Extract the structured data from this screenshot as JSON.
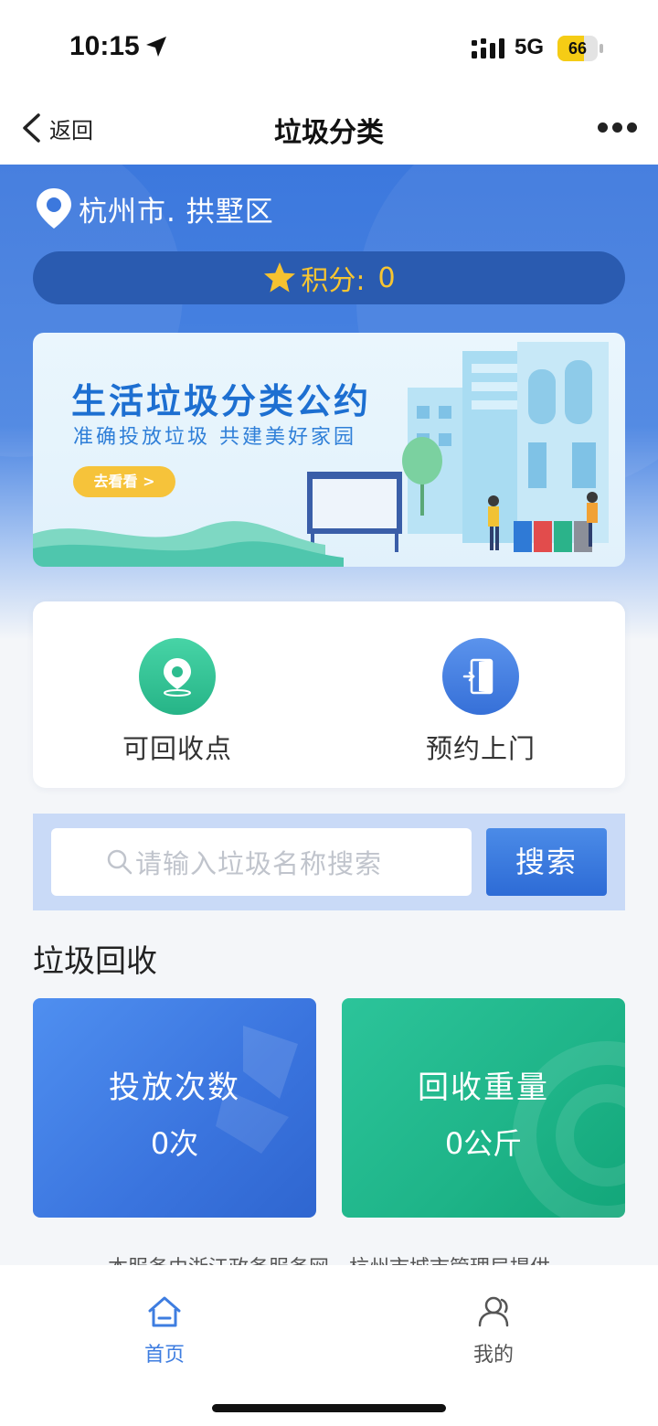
{
  "status_bar": {
    "time": "10:15",
    "network": "5G",
    "battery_level": "66",
    "battery_fraction": 0.66
  },
  "nav": {
    "back_label": "返回",
    "title": "垃圾分类"
  },
  "hero": {
    "location": "杭州市. 拱墅区",
    "points_label": "积分:",
    "points_value": "0"
  },
  "banner": {
    "title": "生活垃圾分类公约",
    "subtitle": "准确投放垃圾 共建美好家园",
    "button_label": "去看看 >"
  },
  "services": [
    {
      "label": "可回收点",
      "icon": "location-pin-icon",
      "color": "#2dc191"
    },
    {
      "label": "预约上门",
      "icon": "door-icon",
      "color": "#3f7be0"
    }
  ],
  "search": {
    "placeholder": "请输入垃圾名称搜索",
    "button_label": "搜索"
  },
  "recycling": {
    "section_title": "垃圾回收",
    "stats": [
      {
        "label": "投放次数",
        "value": "0次",
        "color": "#3f7be0"
      },
      {
        "label": "回收重量",
        "value": "0公斤",
        "color": "#1fb68a"
      }
    ]
  },
  "footer_note": "本服务由浙江政务服务网、杭州市城市管理局提供",
  "tabs": [
    {
      "label": "首页",
      "icon": "home-icon",
      "active": true
    },
    {
      "label": "我的",
      "icon": "user-icon",
      "active": false
    }
  ],
  "colors": {
    "primary": "#3e7de0",
    "accent_yellow": "#f7c531",
    "green": "#1fb68a"
  }
}
